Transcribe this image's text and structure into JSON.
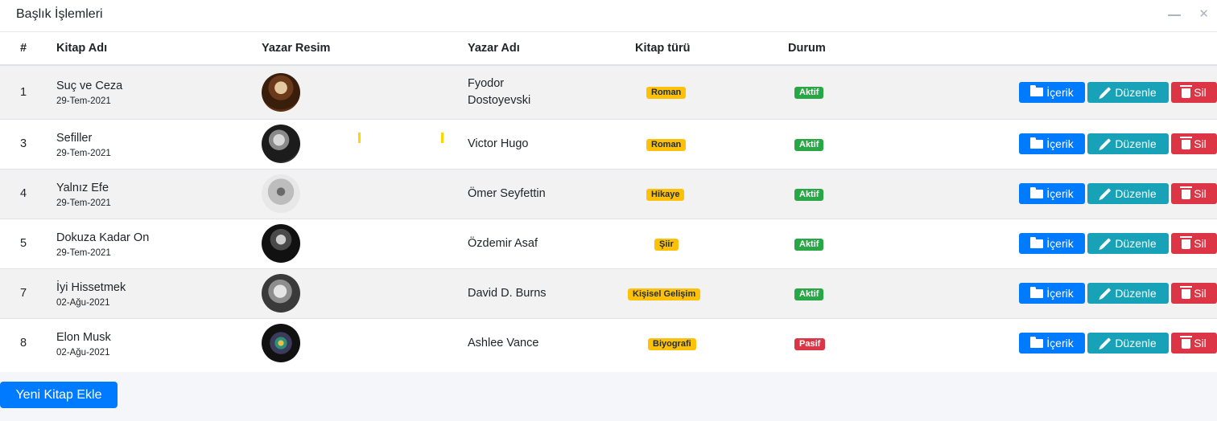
{
  "header": {
    "title": "Başlık İşlemleri"
  },
  "table": {
    "columns": {
      "num": "#",
      "title": "Kitap Adı",
      "author_image": "Yazar Resim",
      "author": "Yazar Adı",
      "genre": "Kitap türü",
      "status": "Durum"
    },
    "rows": [
      {
        "num": "1",
        "title": "Suç ve Ceza",
        "date": "29-Tem-2021",
        "author_line1": "Fyodor",
        "author_line2": "Dostoyevski",
        "genre": "Roman",
        "status": "Aktif",
        "status_type": "success"
      },
      {
        "num": "3",
        "title": "Sefiller",
        "date": "29-Tem-2021",
        "author_line1": "Victor Hugo",
        "author_line2": "",
        "genre": "Roman",
        "status": "Aktif",
        "status_type": "success"
      },
      {
        "num": "4",
        "title": "Yalnız Efe",
        "date": "29-Tem-2021",
        "author_line1": "Ömer Seyfettin",
        "author_line2": "",
        "genre": "Hikaye",
        "status": "Aktif",
        "status_type": "success"
      },
      {
        "num": "5",
        "title": "Dokuza Kadar On",
        "date": "29-Tem-2021",
        "author_line1": "Özdemir Asaf",
        "author_line2": "",
        "genre": "Şiir",
        "status": "Aktif",
        "status_type": "success"
      },
      {
        "num": "7",
        "title": "İyi Hissetmek",
        "date": "02-Ağu-2021",
        "author_line1": "David D. Burns",
        "author_line2": "",
        "genre": "Kişisel Gelişim",
        "status": "Aktif",
        "status_type": "success"
      },
      {
        "num": "8",
        "title": "Elon Musk",
        "date": "02-Ağu-2021",
        "author_line1": "Ashlee Vance",
        "author_line2": "",
        "genre": "Biyografi",
        "status": "Pasif",
        "status_type": "danger"
      }
    ]
  },
  "actions": {
    "content": "İçerik",
    "edit": "Düzenle",
    "delete": "Sil"
  },
  "footer": {
    "add_button": "Yeni Kitap Ekle"
  },
  "colors": {
    "primary": "#007bff",
    "info": "#17a2b8",
    "danger": "#dc3545",
    "success": "#28a745",
    "warning": "#ffc107"
  }
}
